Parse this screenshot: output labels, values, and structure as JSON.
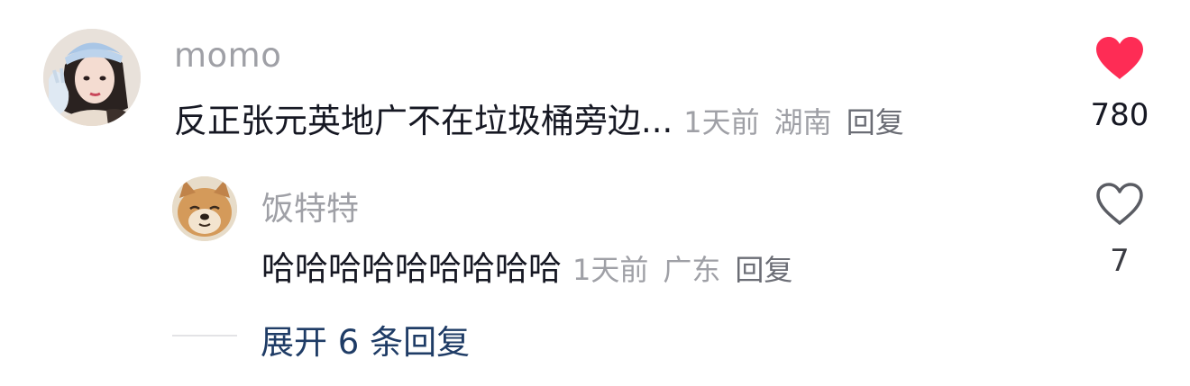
{
  "comment": {
    "username": "momo",
    "text": "反正张元英地广不在垃圾桶旁边...",
    "time": "1天前",
    "location": "湖南",
    "reply_label": "回复",
    "likes": "780",
    "liked": true,
    "like_color": "#fe2c55",
    "avatar": "avatar-girl-icon"
  },
  "reply": {
    "username": "饭特特",
    "text": "哈哈哈哈哈哈哈哈哈",
    "time": "1天前",
    "location": "广东",
    "reply_label": "回复",
    "likes": "7",
    "liked": false,
    "avatar": "avatar-shiba-icon"
  },
  "expand": {
    "label": "展开 6 条回复"
  },
  "colors": {
    "username": "#9fa0a6",
    "text": "#161823",
    "meta": "#9fa0a6",
    "expand": "#1f3c66"
  }
}
